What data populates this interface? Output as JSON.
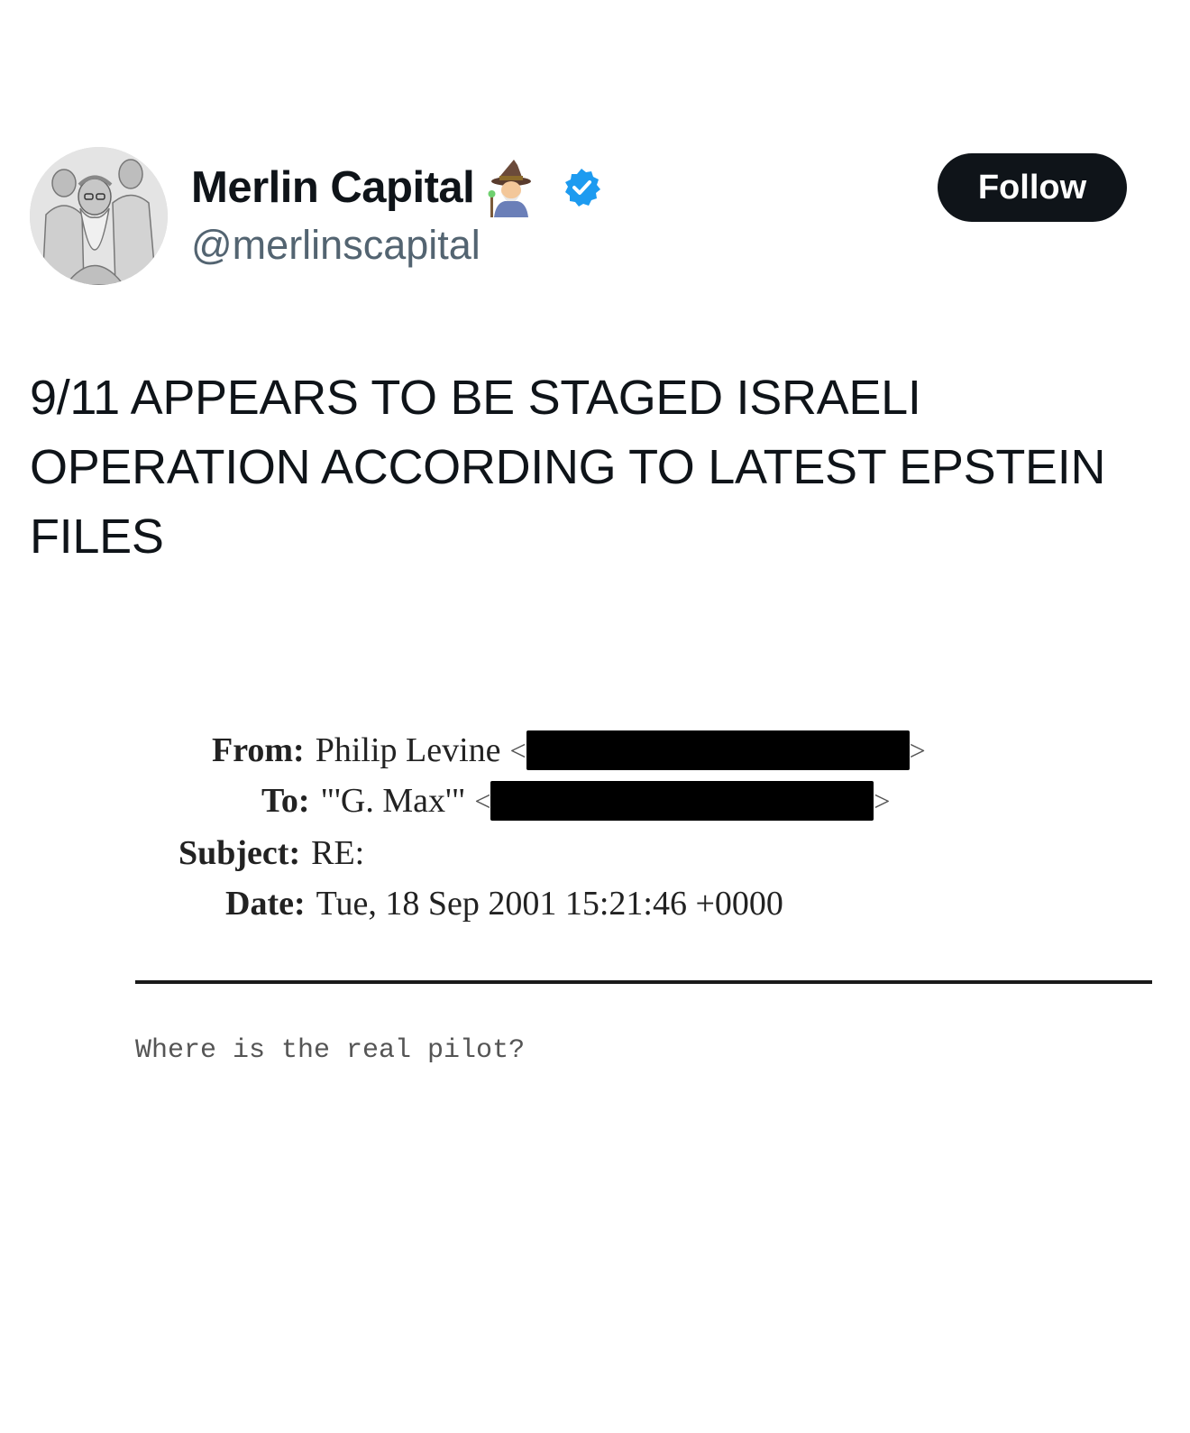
{
  "author": {
    "display_name": "Merlin Capital",
    "handle": "@merlinscapital",
    "name_emoji": "mage-emoji",
    "verified_icon": "verified-badge-icon",
    "verified_color": "#1d9bf0"
  },
  "follow_button": {
    "label": "Follow"
  },
  "tweet": {
    "text": "9/11 APPEARS TO BE STAGED ISRAELI OPERATION ACCORDING TO LATEST EPSTEIN FILES"
  },
  "email": {
    "from_label": "From:",
    "from_value": "Philip Levine",
    "to_label": "To:",
    "to_value": "\"'G. Max'\"",
    "subject_label": "Subject:",
    "subject_value": "RE:",
    "date_label": "Date:",
    "date_value": "Tue, 18 Sep 2001 15:21:46 +0000",
    "body": "Where is the real pilot?"
  }
}
